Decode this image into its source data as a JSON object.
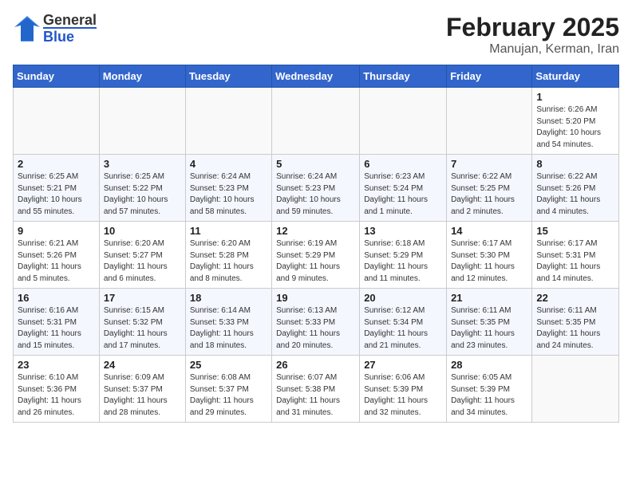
{
  "header": {
    "logo_general": "General",
    "logo_blue": "Blue",
    "title": "February 2025",
    "subtitle": "Manujan, Kerman, Iran"
  },
  "weekdays": [
    "Sunday",
    "Monday",
    "Tuesday",
    "Wednesday",
    "Thursday",
    "Friday",
    "Saturday"
  ],
  "weeks": [
    [
      {
        "day": "",
        "info": ""
      },
      {
        "day": "",
        "info": ""
      },
      {
        "day": "",
        "info": ""
      },
      {
        "day": "",
        "info": ""
      },
      {
        "day": "",
        "info": ""
      },
      {
        "day": "",
        "info": ""
      },
      {
        "day": "1",
        "info": "Sunrise: 6:26 AM\nSunset: 5:20 PM\nDaylight: 10 hours and 54 minutes."
      }
    ],
    [
      {
        "day": "2",
        "info": "Sunrise: 6:25 AM\nSunset: 5:21 PM\nDaylight: 10 hours and 55 minutes."
      },
      {
        "day": "3",
        "info": "Sunrise: 6:25 AM\nSunset: 5:22 PM\nDaylight: 10 hours and 57 minutes."
      },
      {
        "day": "4",
        "info": "Sunrise: 6:24 AM\nSunset: 5:23 PM\nDaylight: 10 hours and 58 minutes."
      },
      {
        "day": "5",
        "info": "Sunrise: 6:24 AM\nSunset: 5:23 PM\nDaylight: 10 hours and 59 minutes."
      },
      {
        "day": "6",
        "info": "Sunrise: 6:23 AM\nSunset: 5:24 PM\nDaylight: 11 hours and 1 minute."
      },
      {
        "day": "7",
        "info": "Sunrise: 6:22 AM\nSunset: 5:25 PM\nDaylight: 11 hours and 2 minutes."
      },
      {
        "day": "8",
        "info": "Sunrise: 6:22 AM\nSunset: 5:26 PM\nDaylight: 11 hours and 4 minutes."
      }
    ],
    [
      {
        "day": "9",
        "info": "Sunrise: 6:21 AM\nSunset: 5:26 PM\nDaylight: 11 hours and 5 minutes."
      },
      {
        "day": "10",
        "info": "Sunrise: 6:20 AM\nSunset: 5:27 PM\nDaylight: 11 hours and 6 minutes."
      },
      {
        "day": "11",
        "info": "Sunrise: 6:20 AM\nSunset: 5:28 PM\nDaylight: 11 hours and 8 minutes."
      },
      {
        "day": "12",
        "info": "Sunrise: 6:19 AM\nSunset: 5:29 PM\nDaylight: 11 hours and 9 minutes."
      },
      {
        "day": "13",
        "info": "Sunrise: 6:18 AM\nSunset: 5:29 PM\nDaylight: 11 hours and 11 minutes."
      },
      {
        "day": "14",
        "info": "Sunrise: 6:17 AM\nSunset: 5:30 PM\nDaylight: 11 hours and 12 minutes."
      },
      {
        "day": "15",
        "info": "Sunrise: 6:17 AM\nSunset: 5:31 PM\nDaylight: 11 hours and 14 minutes."
      }
    ],
    [
      {
        "day": "16",
        "info": "Sunrise: 6:16 AM\nSunset: 5:31 PM\nDaylight: 11 hours and 15 minutes."
      },
      {
        "day": "17",
        "info": "Sunrise: 6:15 AM\nSunset: 5:32 PM\nDaylight: 11 hours and 17 minutes."
      },
      {
        "day": "18",
        "info": "Sunrise: 6:14 AM\nSunset: 5:33 PM\nDaylight: 11 hours and 18 minutes."
      },
      {
        "day": "19",
        "info": "Sunrise: 6:13 AM\nSunset: 5:33 PM\nDaylight: 11 hours and 20 minutes."
      },
      {
        "day": "20",
        "info": "Sunrise: 6:12 AM\nSunset: 5:34 PM\nDaylight: 11 hours and 21 minutes."
      },
      {
        "day": "21",
        "info": "Sunrise: 6:11 AM\nSunset: 5:35 PM\nDaylight: 11 hours and 23 minutes."
      },
      {
        "day": "22",
        "info": "Sunrise: 6:11 AM\nSunset: 5:35 PM\nDaylight: 11 hours and 24 minutes."
      }
    ],
    [
      {
        "day": "23",
        "info": "Sunrise: 6:10 AM\nSunset: 5:36 PM\nDaylight: 11 hours and 26 minutes."
      },
      {
        "day": "24",
        "info": "Sunrise: 6:09 AM\nSunset: 5:37 PM\nDaylight: 11 hours and 28 minutes."
      },
      {
        "day": "25",
        "info": "Sunrise: 6:08 AM\nSunset: 5:37 PM\nDaylight: 11 hours and 29 minutes."
      },
      {
        "day": "26",
        "info": "Sunrise: 6:07 AM\nSunset: 5:38 PM\nDaylight: 11 hours and 31 minutes."
      },
      {
        "day": "27",
        "info": "Sunrise: 6:06 AM\nSunset: 5:39 PM\nDaylight: 11 hours and 32 minutes."
      },
      {
        "day": "28",
        "info": "Sunrise: 6:05 AM\nSunset: 5:39 PM\nDaylight: 11 hours and 34 minutes."
      },
      {
        "day": "",
        "info": ""
      }
    ]
  ]
}
